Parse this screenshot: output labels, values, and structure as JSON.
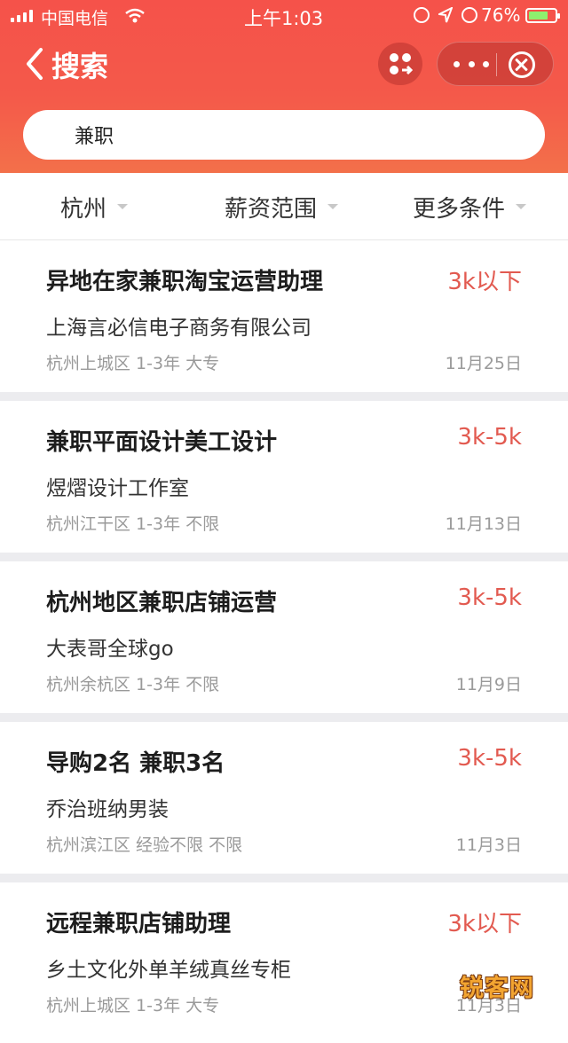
{
  "status_bar": {
    "carrier": "中国电信",
    "time": "上午1:03",
    "battery_pct": "76%",
    "battery_level": 0.76
  },
  "nav": {
    "title": "搜索",
    "icons": [
      "back-chevron-icon",
      "miniprogram-switch-icon",
      "more-icon",
      "close-circle-icon"
    ]
  },
  "search": {
    "value": "兼职"
  },
  "filters": [
    {
      "label": "杭州"
    },
    {
      "label": "薪资范围"
    },
    {
      "label": "更多条件"
    }
  ],
  "jobs": [
    {
      "title": "异地在家兼职淘宝运营助理",
      "salary": "3k以下",
      "company": "上海言必信电子商务有限公司",
      "meta": "杭州上城区  1-3年  大专",
      "date": "11月25日"
    },
    {
      "title": "兼职平面设计美工设计",
      "salary": "3k-5k",
      "company": "煜熠设计工作室",
      "meta": "杭州江干区  1-3年  不限",
      "date": "11月13日"
    },
    {
      "title": "杭州地区兼职店铺运营",
      "salary": "3k-5k",
      "company": "大表哥全球go",
      "meta": "杭州余杭区  1-3年  不限",
      "date": "11月9日"
    },
    {
      "title": "导购2名 兼职3名",
      "salary": "3k-5k",
      "company": "乔治班纳男装",
      "meta": "杭州滨江区  经验不限  不限",
      "date": "11月3日"
    },
    {
      "title": "远程兼职店铺助理",
      "salary": "3k以下",
      "company": "乡土文化外单羊绒真丝专柜",
      "meta": "杭州上城区  1-3年  大专",
      "date": "11月3日"
    }
  ],
  "watermark": "锐客网",
  "colors": {
    "brand_red": "#f5524a",
    "salary_red": "#e25a50",
    "meta_gray": "#9a9a9a"
  }
}
